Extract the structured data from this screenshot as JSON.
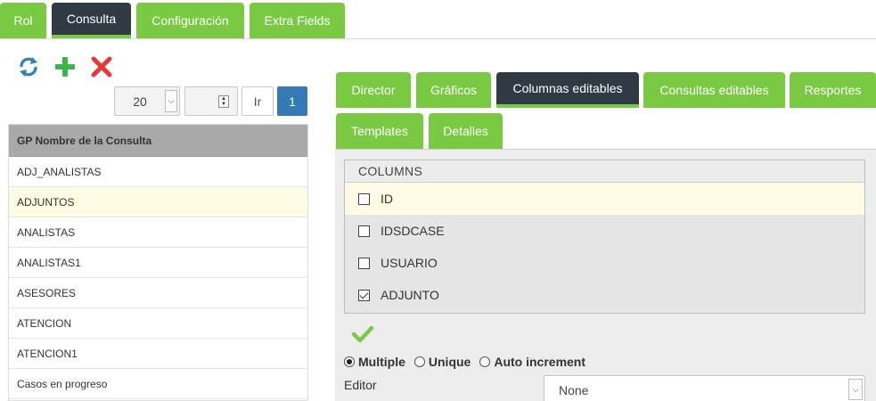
{
  "top_tabs": [
    {
      "label": "Rol"
    },
    {
      "label": "Consulta"
    },
    {
      "label": "Configuración"
    },
    {
      "label": "Extra Fields"
    }
  ],
  "active_top_tab": "Consulta",
  "toolbar": {
    "refresh_icon": "refresh-icon",
    "add_icon": "plus-icon",
    "delete_icon": "close-icon"
  },
  "pager": {
    "page_size": "20",
    "page_input": "",
    "go_label": "Ir",
    "current_page": "1"
  },
  "grid": {
    "header": "GP Nombre de la Consulta",
    "rows": [
      "ADJ_ANALISTAS",
      "ADJUNTOS",
      "ANALISTAS",
      "ANALISTAS1",
      "ASESORES",
      "ATENCION",
      "ATENCION1",
      "Casos en progreso"
    ],
    "selected_row": "ADJUNTOS"
  },
  "sub_tabs": [
    {
      "label": "Director"
    },
    {
      "label": "Gráficos"
    },
    {
      "label": "Columnas editables"
    },
    {
      "label": "Consultas editables"
    },
    {
      "label": "Resportes"
    },
    {
      "label": "Templates"
    },
    {
      "label": "Detalles"
    }
  ],
  "active_sub_tab": "Columnas editables",
  "columns": {
    "header": "COLUMNS",
    "items": [
      {
        "label": "ID",
        "checked": false,
        "highlighted": true
      },
      {
        "label": "IDSDCASE",
        "checked": false,
        "highlighted": false
      },
      {
        "label": "USUARIO",
        "checked": false,
        "highlighted": false
      },
      {
        "label": "ADJUNTO",
        "checked": true,
        "highlighted": false
      }
    ]
  },
  "mode": {
    "options": [
      "Multiple",
      "Unique",
      "Auto increment"
    ],
    "selected": "Multiple"
  },
  "editor": {
    "label": "Editor",
    "value": "None"
  },
  "colors": {
    "accent_green": "#7ac943",
    "active_dark": "#2f3a44",
    "page_blue": "#337ab7",
    "delete_red": "#e53935",
    "refresh_blue": "#2f7fc4",
    "highlight": "#fdfbe3"
  }
}
